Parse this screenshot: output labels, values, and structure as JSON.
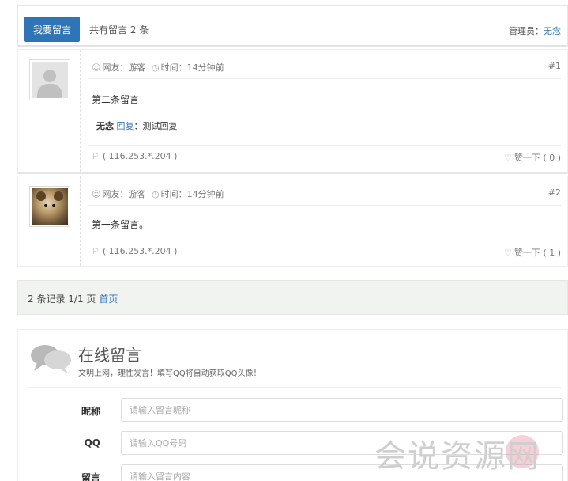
{
  "header": {
    "leave_message_button": "我要留言",
    "total_text": "共有留言 2 条",
    "admin_label": "管理员：",
    "admin_name": "无念"
  },
  "messages": [
    {
      "user_text": "网友：游客",
      "time_text": "时间：14分钟前",
      "floor": "#1",
      "content": "第二条留言",
      "reply": {
        "who": "无念",
        "reply_word": "回复",
        "text": "：测试回复"
      },
      "ip": "( 116.253.*.204 )",
      "like": "赞一下 ( 0 )",
      "avatar": "default-avatar"
    },
    {
      "user_text": "网友：游客",
      "time_text": "时间：14分钟前",
      "floor": "#2",
      "content": "第一条留言。",
      "reply": null,
      "ip": "( 116.253.*.204 )",
      "like": "赞一下 ( 1 )",
      "avatar": "photo-avatar"
    }
  ],
  "pager": {
    "text": "2 条记录 1/1 页",
    "home_link": "首页"
  },
  "form": {
    "title": "在线留言",
    "subtitle": "文明上网，理性发言！填写QQ将自动获取QQ头像！",
    "fields": [
      {
        "label": "昵称",
        "placeholder": "请输入留言昵称"
      },
      {
        "label": "QQ",
        "placeholder": "请输入QQ号码"
      },
      {
        "label": "留言",
        "placeholder": "请输入留言内容"
      }
    ]
  },
  "watermark": "会说资源网",
  "icons": {
    "user": "user-icon",
    "clock": "clock-icon",
    "ip": "location-flag-icon",
    "like": "heart-icon",
    "chat": "chat-bubbles-icon"
  },
  "colors": {
    "primary": "#2f74b7",
    "link": "#2f74b7",
    "pager_bg": "#f1f3f1"
  }
}
